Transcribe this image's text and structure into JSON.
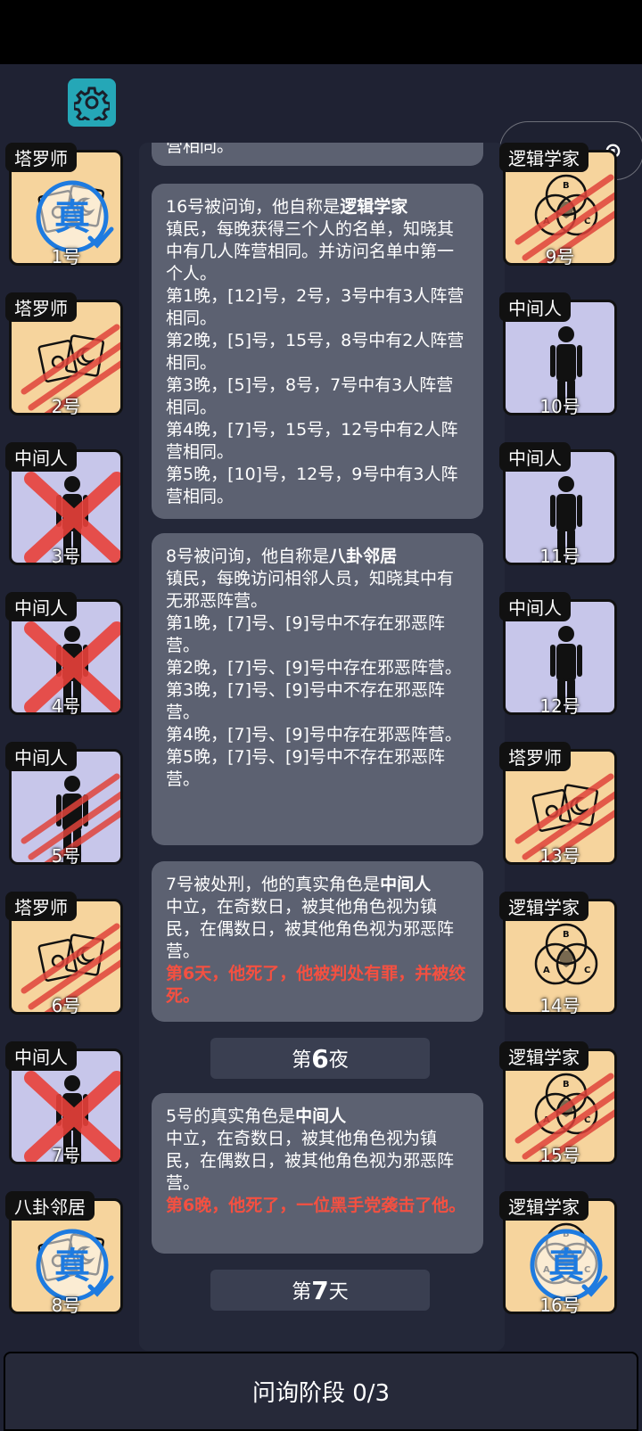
{
  "capsule": {
    "more": "•••",
    "close": "⊙"
  },
  "top_fragment": "营相同。",
  "messages": [
    {
      "head": "16号被问询，他自称是",
      "role": "逻辑学家",
      "body": "镇民，每晚获得三个人的名单，知晓其中有几人阵营相同。并访问名单中第一个人。\n第1晚，[12]号，2号，3号中有3人阵营相同。\n第2晚，[5]号，15号，8号中有2人阵营相同。\n第3晚，[5]号，8号，7号中有3人阵营相同。\n第4晚，[7]号，15号，12号中有2人阵营相同。\n第5晚，[10]号，12号，9号中有3人阵营相同。"
    },
    {
      "head": "8号被问询，他自称是",
      "role": "八卦邻居",
      "body": "镇民，每晚访问相邻人员，知晓其中有无邪恶阵营。\n第1晚，[7]号、[9]号中不存在邪恶阵营。\n第2晚，[7]号、[9]号中存在邪恶阵营。\n第3晚，[7]号、[9]号中不存在邪恶阵营。\n第4晚，[7]号、[9]号中存在邪恶阵营。\n第5晚，[7]号、[9]号中不存在邪恶阵营。"
    },
    {
      "head": "7号被处刑，他的真实角色是",
      "role": "中间人",
      "body": "中立，在奇数日，被其他角色视为镇民，在偶数日，被其他角色视为邪恶阵营。",
      "alert": "第6天，他死了，他被判处有罪，并被绞死。"
    }
  ],
  "night6": {
    "pre": "第",
    "num": "6",
    "post": "夜"
  },
  "msg4": {
    "head": "5号的真实角色是",
    "role": "中间人",
    "body": "中立，在奇数日，被其他角色视为镇民，在偶数日，被其他角色视为邪恶阵营。",
    "alert": "第6晚，他死了，一位黑手党袭击了他。"
  },
  "day7": {
    "pre": "第",
    "num": "7",
    "post": "天"
  },
  "bottom": "问询阶段 0/3",
  "true_mark": "真",
  "venn": {
    "a": "A",
    "b": "B",
    "c": "C"
  },
  "players_left": [
    {
      "role": "塔罗师",
      "num": "1号",
      "type": "tarot",
      "state": "true"
    },
    {
      "role": "塔罗师",
      "num": "2号",
      "type": "tarot",
      "state": "claw"
    },
    {
      "role": "中间人",
      "num": "3号",
      "type": "man",
      "state": "x"
    },
    {
      "role": "中间人",
      "num": "4号",
      "type": "man",
      "state": "x"
    },
    {
      "role": "中间人",
      "num": "5号",
      "type": "man",
      "state": "claw"
    },
    {
      "role": "塔罗师",
      "num": "6号",
      "type": "tarot",
      "state": "claw"
    },
    {
      "role": "中间人",
      "num": "7号",
      "type": "man",
      "state": "x"
    },
    {
      "role": "八卦邻居",
      "num": "8号",
      "type": "tarot",
      "state": "true"
    }
  ],
  "players_right": [
    {
      "role": "逻辑学家",
      "num": "9号",
      "type": "venn",
      "state": "claw"
    },
    {
      "role": "中间人",
      "num": "10号",
      "type": "man",
      "state": "none"
    },
    {
      "role": "中间人",
      "num": "11号",
      "type": "man",
      "state": "none"
    },
    {
      "role": "中间人",
      "num": "12号",
      "type": "man",
      "state": "none"
    },
    {
      "role": "塔罗师",
      "num": "13号",
      "type": "tarot",
      "state": "claw"
    },
    {
      "role": "逻辑学家",
      "num": "14号",
      "type": "venn",
      "state": "none"
    },
    {
      "role": "逻辑学家",
      "num": "15号",
      "type": "venn",
      "state": "claw"
    },
    {
      "role": "逻辑学家",
      "num": "16号",
      "type": "venn",
      "state": "true"
    }
  ],
  "colors": {
    "accent": "#25a7b7",
    "alert": "#f45041",
    "card_yellow": "#f6d49d",
    "card_purple": "#c7c6ea",
    "true_blue": "#1e7be0"
  }
}
